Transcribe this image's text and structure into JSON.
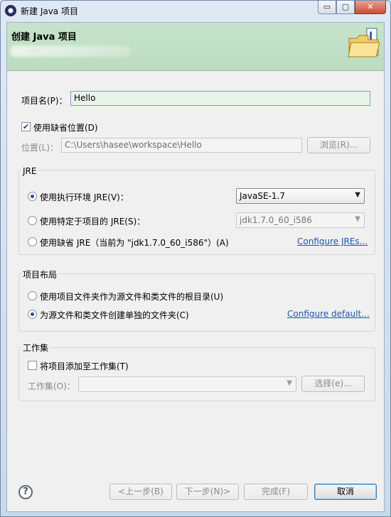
{
  "window": {
    "title": "新建 Java 项目",
    "min_glyph": "▭",
    "max_glyph": "▢",
    "close_glyph": "✕"
  },
  "banner": {
    "title": "创建 Java 项目",
    "icon": "java-project-folder-icon"
  },
  "project_name": {
    "label": "项目名(P)：",
    "value": "Hello"
  },
  "use_default_location": {
    "label": "使用缺省位置(D)",
    "checked": true
  },
  "location": {
    "label": "位置(L)：",
    "value": "C:\\Users\\hasee\\workspace\\Hello",
    "browse_label": "浏览(R)..."
  },
  "jre": {
    "group_title": "JRE",
    "options": [
      {
        "label": "使用执行环境 JRE(V)：",
        "selected": true
      },
      {
        "label": "使用特定于项目的 JRE(S)：",
        "selected": false
      },
      {
        "label": "使用缺省 JRE（当前为 \"jdk1.7.0_60_i586\"）(A)",
        "selected": false
      }
    ],
    "execution_env": "JavaSE-1.7",
    "specific_jre": "jdk1.7.0_60_i586",
    "configure_link": "Configure JREs..."
  },
  "layout": {
    "group_title": "项目布局",
    "options": [
      {
        "label": "使用项目文件夹作为源文件和类文件的根目录(U)",
        "selected": false
      },
      {
        "label": "为源文件和类文件创建单独的文件夹(C)",
        "selected": true
      }
    ],
    "configure_link": "Configure default..."
  },
  "working_sets": {
    "group_title": "工作集",
    "add_label": "将项目添加至工作集(T)",
    "add_checked": false,
    "field_label": "工作集(O)：",
    "field_value": "",
    "select_label": "选择(e)..."
  },
  "footer": {
    "back_label": "<上一步(B)",
    "next_label": "下一步(N)>",
    "finish_label": "完成(F)",
    "cancel_label": "取消",
    "help_glyph": "?"
  }
}
